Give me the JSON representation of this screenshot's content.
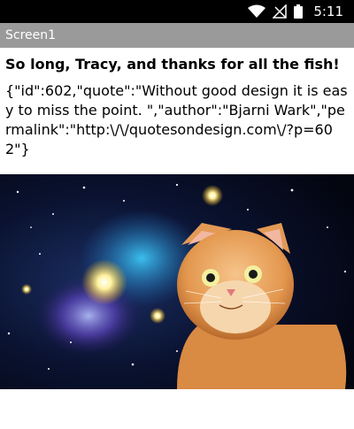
{
  "status_bar": {
    "time": "5:11",
    "icons": [
      "wifi-icon",
      "no-signal-icon",
      "battery-icon"
    ]
  },
  "app": {
    "title": "Screen1"
  },
  "main": {
    "headline": "So long, Tracy, and thanks for all the fish!",
    "quote_json": "{\"id\":602,\"quote\":\"Without good design it is easy to miss the point.  \",\"author\":\"Bjarni Wark\",\"permalink\":\"http:\\/\\/quotesondesign.com\\/?p=602\"}",
    "image": {
      "subject": "cat in space",
      "icon": "cat-space-image"
    }
  }
}
